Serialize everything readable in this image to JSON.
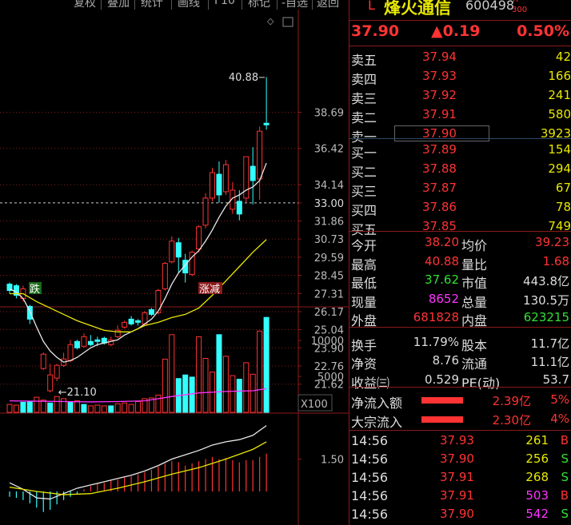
{
  "toolbar": {
    "items": [
      "复权",
      "叠加",
      "统计",
      "画线",
      "F10",
      "标记",
      "-自选",
      "返回"
    ]
  },
  "stock": {
    "prefix": "L",
    "name": "烽火通信",
    "code": "600498",
    "badge_top": "R",
    "badge_bottom": "300",
    "price": "37.90",
    "change": "▲0.19",
    "change_pct": "0.50%"
  },
  "chart": {
    "price_ticks": [
      "38.69",
      "36.42",
      "34.14",
      "33.00",
      "31.86",
      "30.73",
      "29.59",
      "28.45",
      "27.31",
      "26.17",
      "25.04",
      "23.90",
      "22.76",
      "21.62"
    ],
    "high_label": "40.88",
    "low_label": "21.10",
    "tag_drop": "跌",
    "tag_up": "涨减",
    "vol_ticks": [
      "10000",
      "5000"
    ],
    "vol_unit": "X100",
    "macd_tick": "1.50",
    "candles": [
      [
        0,
        27.9,
        27.5,
        28.0,
        27.3
      ],
      [
        1,
        27.8,
        27.2,
        27.9,
        27.0
      ],
      [
        2,
        27.0,
        27.6,
        27.8,
        26.8
      ],
      [
        3,
        26.5,
        25.7,
        26.6,
        25.4
      ],
      [
        5,
        22.6,
        23.5,
        23.6,
        22.5
      ],
      [
        6,
        21.2,
        22.2,
        22.9,
        21.1
      ],
      [
        7,
        22.0,
        22.8,
        22.9,
        21.8
      ],
      [
        8,
        22.8,
        23.2,
        23.6,
        22.7
      ],
      [
        9,
        23.1,
        24.1,
        24.4,
        23.0
      ],
      [
        10,
        24.3,
        23.9,
        24.4,
        23.8
      ],
      [
        11,
        24.0,
        24.6,
        24.8,
        23.9
      ],
      [
        12,
        24.3,
        24.1,
        24.7,
        24.0
      ],
      [
        13,
        24.4,
        24.3,
        24.6,
        24.0
      ],
      [
        14,
        24.5,
        24.2,
        24.6,
        24.1
      ],
      [
        15,
        24.1,
        24.4,
        24.6,
        24.0
      ],
      [
        16,
        24.6,
        25.0,
        25.3,
        24.5
      ],
      [
        17,
        25.2,
        25.5,
        25.6,
        25.1
      ],
      [
        18,
        25.7,
        25.4,
        25.9,
        25.3
      ],
      [
        19,
        25.6,
        25.5,
        25.7,
        25.3
      ],
      [
        20,
        25.4,
        26.1,
        26.2,
        25.3
      ],
      [
        21,
        26.3,
        26.0,
        26.4,
        25.9
      ],
      [
        22,
        26.1,
        27.5,
        27.6,
        26.0
      ],
      [
        23,
        27.6,
        29.2,
        29.3,
        27.5
      ],
      [
        24,
        29.3,
        30.6,
        30.9,
        29.2
      ],
      [
        25,
        30.5,
        29.6,
        30.8,
        28.6
      ],
      [
        26,
        29.4,
        28.6,
        29.8,
        28.0
      ],
      [
        27,
        28.5,
        29.9,
        30.0,
        28.4
      ],
      [
        28,
        30.1,
        31.5,
        31.6,
        29.9
      ],
      [
        29,
        31.6,
        33.3,
        33.6,
        31.4
      ],
      [
        30,
        33.3,
        34.9,
        35.2,
        33.1
      ],
      [
        31,
        34.8,
        33.5,
        35.6,
        33.0
      ],
      [
        32,
        33.7,
        35.4,
        35.7,
        33.5
      ],
      [
        33,
        32.6,
        33.8,
        34.3,
        32.3
      ],
      [
        34,
        33.1,
        32.3,
        33.8,
        31.9
      ],
      [
        35,
        33.3,
        35.9,
        35.9,
        33.0
      ],
      [
        36,
        35.3,
        34.4,
        36.5,
        32.9
      ],
      [
        37,
        34.5,
        37.5,
        37.8,
        33.2
      ],
      [
        38,
        38.0,
        37.9,
        40.9,
        37.6
      ]
    ],
    "ma5": [
      [
        0,
        27.6
      ],
      [
        1,
        27.4
      ],
      [
        2,
        27.0
      ],
      [
        3,
        26.2
      ],
      [
        4,
        25.2
      ],
      [
        5,
        24.3
      ],
      [
        6,
        23.7
      ],
      [
        7,
        23.3
      ],
      [
        8,
        23.0
      ],
      [
        9,
        23.1
      ],
      [
        10,
        23.3
      ],
      [
        11,
        23.6
      ],
      [
        12,
        23.9
      ],
      [
        13,
        24.1
      ],
      [
        14,
        24.2
      ],
      [
        15,
        24.3
      ],
      [
        16,
        24.4
      ],
      [
        17,
        24.7
      ],
      [
        18,
        24.9
      ],
      [
        19,
        25.1
      ],
      [
        20,
        25.4
      ],
      [
        21,
        25.7
      ],
      [
        22,
        26.2
      ],
      [
        23,
        27.0
      ],
      [
        24,
        27.9
      ],
      [
        25,
        28.6
      ],
      [
        26,
        29.1
      ],
      [
        27,
        29.6
      ],
      [
        28,
        30.0
      ],
      [
        29,
        30.6
      ],
      [
        30,
        31.3
      ],
      [
        31,
        32.1
      ],
      [
        32,
        32.8
      ],
      [
        33,
        33.3
      ],
      [
        34,
        33.5
      ],
      [
        35,
        33.8
      ],
      [
        36,
        34.0
      ],
      [
        37,
        34.4
      ],
      [
        38,
        35.5
      ]
    ],
    "ma20": [
      [
        0,
        27.3
      ],
      [
        2,
        27.3
      ],
      [
        4,
        26.8
      ],
      [
        6,
        26.4
      ],
      [
        8,
        26.0
      ],
      [
        10,
        25.6
      ],
      [
        12,
        25.3
      ],
      [
        14,
        25.0
      ],
      [
        16,
        24.9
      ],
      [
        18,
        24.9
      ],
      [
        20,
        25.3
      ],
      [
        22,
        25.5
      ],
      [
        24,
        25.8
      ],
      [
        26,
        26.0
      ],
      [
        28,
        26.4
      ],
      [
        30,
        27.2
      ],
      [
        32,
        28.1
      ],
      [
        34,
        29.0
      ],
      [
        36,
        29.9
      ],
      [
        38,
        30.7
      ]
    ],
    "volume": [
      [
        0,
        1100,
        "up"
      ],
      [
        1,
        1000,
        "up"
      ],
      [
        2,
        1400,
        "down"
      ],
      [
        3,
        1500,
        "down"
      ],
      [
        4,
        2100,
        "up"
      ],
      [
        5,
        1700,
        "up"
      ],
      [
        6,
        1300,
        "down"
      ],
      [
        7,
        2200,
        "up"
      ],
      [
        8,
        1900,
        "up"
      ],
      [
        9,
        1400,
        "down"
      ],
      [
        10,
        1600,
        "up"
      ],
      [
        11,
        1100,
        "down"
      ],
      [
        12,
        900,
        "up"
      ],
      [
        13,
        1000,
        "up"
      ],
      [
        14,
        900,
        "up"
      ],
      [
        15,
        900,
        "down"
      ],
      [
        16,
        1200,
        "up"
      ],
      [
        17,
        1300,
        "up"
      ],
      [
        18,
        1100,
        "up"
      ],
      [
        19,
        1500,
        "up"
      ],
      [
        20,
        1900,
        "up"
      ],
      [
        21,
        2000,
        "up"
      ],
      [
        22,
        2400,
        "up"
      ],
      [
        23,
        7400,
        "up"
      ],
      [
        24,
        10800,
        "up"
      ],
      [
        25,
        4700,
        "down"
      ],
      [
        26,
        5200,
        "down"
      ],
      [
        27,
        4900,
        "down"
      ],
      [
        28,
        10500,
        "up"
      ],
      [
        29,
        7500,
        "up"
      ],
      [
        30,
        5600,
        "up"
      ],
      [
        31,
        10800,
        "down"
      ],
      [
        32,
        7800,
        "up"
      ],
      [
        33,
        5100,
        "up"
      ],
      [
        34,
        4600,
        "down"
      ],
      [
        35,
        6900,
        "up"
      ],
      [
        36,
        5300,
        "up"
      ],
      [
        37,
        11300,
        "up"
      ],
      [
        38,
        13200,
        "down"
      ]
    ],
    "vol_ma": [
      [
        0,
        1600
      ],
      [
        4,
        1550
      ],
      [
        8,
        1500
      ],
      [
        12,
        1450
      ],
      [
        16,
        1500
      ],
      [
        20,
        1600
      ],
      [
        24,
        2200
      ],
      [
        28,
        2700
      ],
      [
        32,
        2900
      ],
      [
        36,
        3000
      ],
      [
        38,
        3300
      ]
    ],
    "macd_hist": [
      [
        0,
        -0.25
      ],
      [
        1,
        -0.3
      ],
      [
        2,
        -0.4
      ],
      [
        3,
        -0.55
      ],
      [
        4,
        -0.75
      ],
      [
        5,
        -0.95
      ],
      [
        6,
        -0.85
      ],
      [
        7,
        -0.6
      ],
      [
        8,
        -0.4
      ],
      [
        9,
        -0.25
      ],
      [
        10,
        -0.1
      ],
      [
        11,
        0.1
      ],
      [
        12,
        0.25
      ],
      [
        13,
        0.35
      ],
      [
        14,
        0.4
      ],
      [
        15,
        0.5
      ],
      [
        16,
        0.55
      ],
      [
        17,
        0.65
      ],
      [
        18,
        0.7
      ],
      [
        19,
        0.8
      ],
      [
        20,
        0.9
      ],
      [
        21,
        1.0
      ],
      [
        22,
        1.15
      ],
      [
        23,
        1.3
      ],
      [
        24,
        1.4
      ],
      [
        25,
        1.35
      ],
      [
        26,
        1.2
      ],
      [
        27,
        1.3
      ],
      [
        28,
        1.4
      ],
      [
        29,
        1.5
      ],
      [
        30,
        1.6
      ],
      [
        31,
        1.5
      ],
      [
        32,
        1.55
      ],
      [
        33,
        1.45
      ],
      [
        34,
        1.35
      ],
      [
        35,
        1.45
      ],
      [
        36,
        1.45
      ],
      [
        37,
        1.6
      ],
      [
        38,
        1.75
      ]
    ],
    "dif": [
      [
        0,
        0.4
      ],
      [
        2,
        0.1
      ],
      [
        4,
        -0.3
      ],
      [
        6,
        -0.35
      ],
      [
        8,
        -0.1
      ],
      [
        10,
        0.15
      ],
      [
        12,
        0.3
      ],
      [
        14,
        0.45
      ],
      [
        16,
        0.6
      ],
      [
        18,
        0.75
      ],
      [
        20,
        0.95
      ],
      [
        22,
        1.2
      ],
      [
        24,
        1.5
      ],
      [
        26,
        1.7
      ],
      [
        28,
        1.9
      ],
      [
        30,
        2.15
      ],
      [
        32,
        2.3
      ],
      [
        34,
        2.4
      ],
      [
        36,
        2.6
      ],
      [
        38,
        3.05
      ]
    ],
    "dea": [
      [
        0,
        0.2
      ],
      [
        4,
        0.0
      ],
      [
        8,
        -0.15
      ],
      [
        12,
        -0.1
      ],
      [
        16,
        0.15
      ],
      [
        20,
        0.45
      ],
      [
        24,
        0.8
      ],
      [
        28,
        1.1
      ],
      [
        32,
        1.5
      ],
      [
        36,
        1.95
      ],
      [
        38,
        2.3
      ]
    ]
  },
  "book": {
    "sells": [
      [
        "卖五",
        "37.94",
        "42"
      ],
      [
        "卖四",
        "37.93",
        "166"
      ],
      [
        "卖三",
        "37.92",
        "241"
      ],
      [
        "卖二",
        "37.91",
        "580"
      ],
      [
        "卖一",
        "37.90",
        "3923"
      ]
    ],
    "buys": [
      [
        "买一",
        "37.89",
        "154"
      ],
      [
        "买二",
        "37.88",
        "294"
      ],
      [
        "买三",
        "37.87",
        "67"
      ],
      [
        "买四",
        "37.86",
        "78"
      ],
      [
        "买五",
        "37.85",
        "749"
      ]
    ]
  },
  "stats": {
    "open_l": "今开",
    "open": "38.20",
    "avg_l": "均价",
    "avg": "39.23",
    "high_l": "最高",
    "high": "40.88",
    "ratio_l": "量比",
    "ratio": "1.68",
    "low_l": "最低",
    "low": "37.62",
    "mcap_l": "市值",
    "mcap": "443.8亿",
    "now_l": "现量",
    "now": "8652",
    "total_l": "总量",
    "total": "130.5万",
    "out_l": "外盘",
    "out": "681828",
    "in_l": "内盘",
    "in": "623215",
    "turn_l": "换手",
    "turn": "11.79%",
    "share_l": "股本",
    "share": "11.7亿",
    "nav_l": "净资",
    "nav": "8.76",
    "float_l": "流通",
    "float": "11.1亿",
    "eps_l": "收益㈢",
    "eps": "0.529",
    "pe_l": "PE(动)",
    "pe": "53.7"
  },
  "flow": {
    "net_l": "净流入额",
    "net": "2.39亿",
    "net_pct": "5%",
    "big_l": "大宗流入",
    "big": "2.30亿",
    "big_pct": "4%"
  },
  "ticks": [
    [
      "14:56",
      "37.93",
      "261",
      "B"
    ],
    [
      "14:56",
      "37.90",
      "256",
      "S"
    ],
    [
      "14:56",
      "37.91",
      "268",
      "S"
    ],
    [
      "14:56",
      "37.91",
      "503",
      "B"
    ],
    [
      "14:56",
      "37.90",
      "542",
      "S"
    ]
  ],
  "colors": {
    "up": "#ff3333",
    "down": "#33ffff",
    "ma5": "#e8e8e8",
    "ma20": "#e8e800",
    "vol_ma": "#ff33ff"
  }
}
